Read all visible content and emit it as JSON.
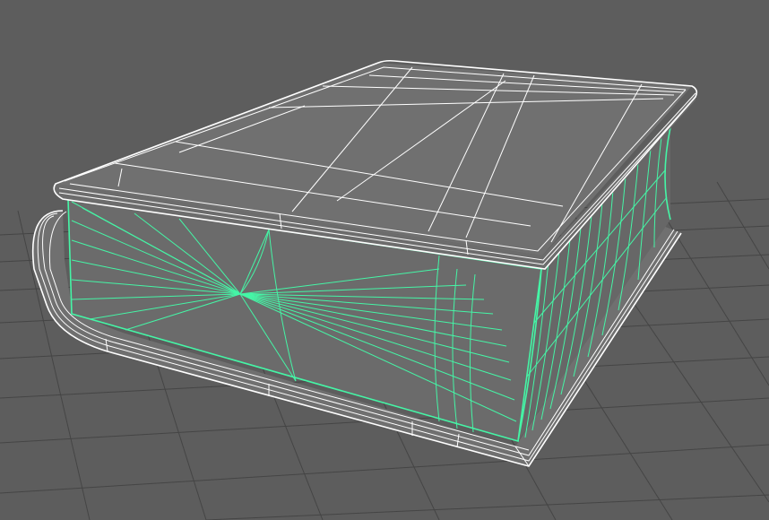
{
  "viewport": {
    "background": "#5d5d5d",
    "grid_color": "#454545",
    "axis_color": "#2e2e2e",
    "wire_color": "#ffffff",
    "selection_color": "#45f5a6",
    "surface_color": "#707070"
  }
}
